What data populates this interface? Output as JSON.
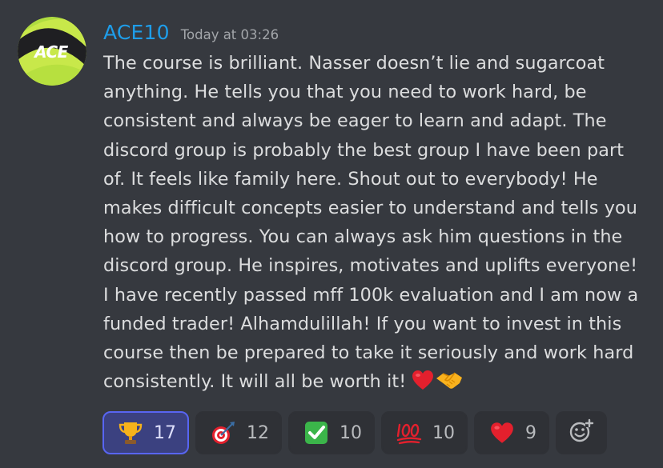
{
  "message": {
    "author": {
      "username": "ACE10",
      "avatar_text": "ACE",
      "username_color": "#1e9de9"
    },
    "timestamp": "Today at 03:26",
    "text": "The course is brilliant. Nasser doesn’t lie and sugarcoat anything. He tells you that you need to work hard, be consistent and always be eager to learn and adapt. The discord group is probably the best group I have been part of. It feels like family here. Shout out to everybody! He makes difficult concepts easier to understand and tells you how to progress. You can always ask him questions in the discord group. He inspires, motivates and uplifts everyone! I have recently passed mff 100k evaluation and I am now a funded trader! Alhamdulillah! If you want to invest in this course then be prepared to take it seriously and work hard consistently. It will all be worth it!",
    "trailing_emojis": [
      "red-heart",
      "handshake"
    ]
  },
  "reactions": [
    {
      "emoji": "trophy",
      "count": "17",
      "active": true
    },
    {
      "emoji": "direct-hit",
      "count": "12",
      "active": false
    },
    {
      "emoji": "check-mark-button",
      "count": "10",
      "active": false
    },
    {
      "emoji": "hundred-points",
      "count": "10",
      "active": false
    },
    {
      "emoji": "red-heart",
      "count": "9",
      "active": false
    }
  ],
  "add_reaction": {
    "icon": "add-reaction-icon"
  },
  "colors": {
    "background": "#36393f",
    "text": "#dcddde",
    "timestamp": "#a3a6aa",
    "reaction_bg": "#2f3136",
    "reaction_active_bg": "#3b4180",
    "reaction_active_border": "#5865f2"
  }
}
